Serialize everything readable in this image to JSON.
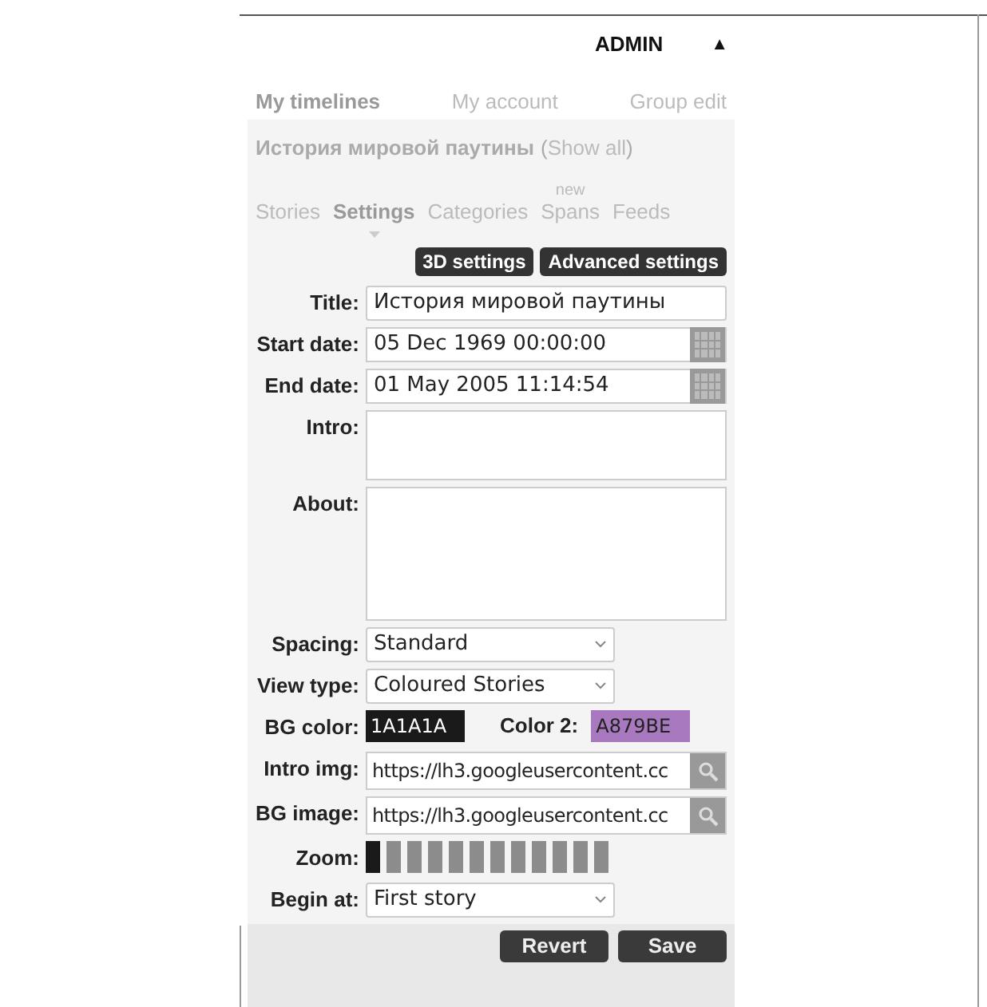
{
  "header": {
    "user": "ADMIN",
    "toggle": "▲"
  },
  "nav": [
    {
      "label": "My timelines",
      "selected": true
    },
    {
      "label": "My account",
      "selected": false
    },
    {
      "label": "Group edit",
      "selected": false
    }
  ],
  "timeline": {
    "title": "История мировой паутины",
    "show_all_open": "(",
    "show_all": "Show all",
    "show_all_close": ")"
  },
  "tabs": [
    {
      "label": "Stories",
      "selected": false
    },
    {
      "label": "Settings",
      "selected": true
    },
    {
      "label": "Categories",
      "selected": false
    },
    {
      "label": "Spans",
      "badge": "new",
      "selected": false
    },
    {
      "label": "Feeds",
      "selected": false
    }
  ],
  "buttons": [
    "3D settings",
    "Advanced settings"
  ],
  "form": [
    {
      "kind": "text",
      "label": "Title:",
      "value": "История мировой паутины"
    },
    {
      "kind": "date",
      "label": "Start date:",
      "value": "05 Dec 1969 00:00:00"
    },
    {
      "kind": "date",
      "label": "End date:",
      "value": "01 May 2005 11:14:54"
    },
    {
      "kind": "area",
      "label": "Intro:"
    },
    {
      "kind": "tallarea",
      "label": "About:"
    },
    {
      "kind": "select",
      "label": "Spacing:",
      "value": "Standard"
    },
    {
      "kind": "select",
      "label": "View type:",
      "value": "Coloured Stories"
    },
    {
      "kind": "colors",
      "label": "BG color:",
      "value": "1A1A1A",
      "label2": "Color 2:",
      "value2": "A879BE"
    },
    {
      "kind": "image",
      "label": "Intro img:",
      "value": "https://lh3.googleusercontent.cc"
    },
    {
      "kind": "image",
      "label": "BG image:",
      "value": "https://lh3.googleusercontent.cc"
    },
    {
      "kind": "zoom",
      "label": "Zoom:",
      "segments": [
        {
          "selected": true
        },
        {
          "selected": false
        },
        {
          "selected": false
        },
        {
          "selected": false
        },
        {
          "selected": false
        },
        {
          "selected": false
        },
        {
          "selected": false
        },
        {
          "selected": false
        },
        {
          "selected": false
        },
        {
          "selected": false
        },
        {
          "selected": false
        },
        {
          "selected": false
        }
      ]
    },
    {
      "kind": "select",
      "label": "Begin at:",
      "value": "First story"
    }
  ],
  "actions": [
    "Revert",
    "Save"
  ]
}
